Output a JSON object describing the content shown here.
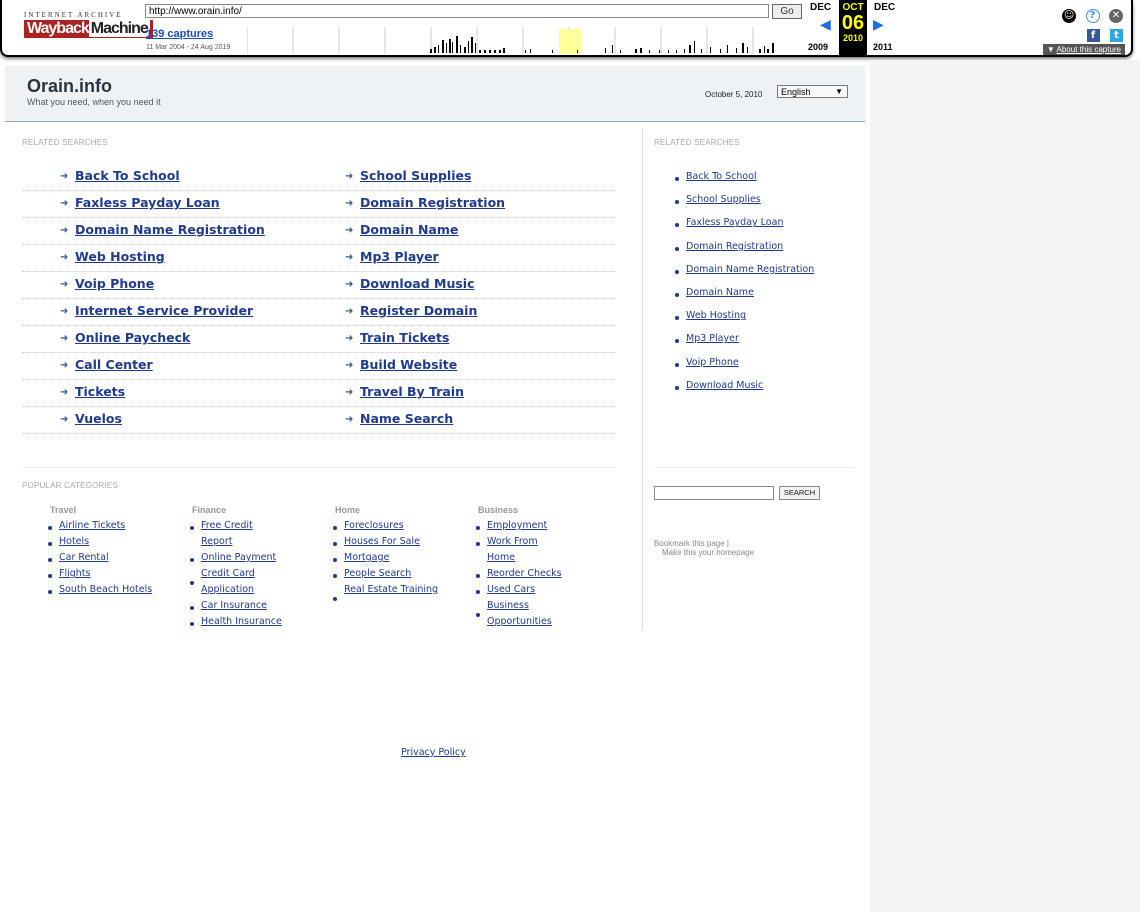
{
  "toolbar": {
    "ia_label": "INTERNET ARCHIVE",
    "logo": "WaybackMachine",
    "url_value": "http://www.orain.info/",
    "go_label": "Go",
    "captures_label": "139 captures",
    "date_range": "11 Mar 2004 - 24 Aug 2019",
    "prev_month": "DEC",
    "cur_month": "OCT",
    "next_month": "DEC",
    "cur_day": "06",
    "prev_year": "2009",
    "cur_year": "2010",
    "next_year": "2011",
    "about_label": "About this capture"
  },
  "header": {
    "site_title": "Orain.info",
    "tagline": "What you need, when you need it",
    "date": "October 5, 2010",
    "language": "English"
  },
  "related_label": "RELATED SEARCHES",
  "related_left": [
    "Back To School",
    "Faxless Payday Loan",
    "Domain Name Registration",
    "Web Hosting",
    "Voip Phone",
    "Internet Service Provider",
    "Online Paycheck",
    "Call Center",
    "Tickets",
    "Vuelos"
  ],
  "related_right": [
    "School Supplies",
    "Domain Registration",
    "Domain Name",
    "Mp3 Player",
    "Download Music",
    "Register Domain",
    "Train Tickets",
    "Build Website",
    "Travel By Train",
    "Name Search"
  ],
  "sidebar": {
    "label": "RELATED SEARCHES",
    "items": [
      "Back To School",
      "School Supplies",
      "Faxless Payday Loan",
      "Domain Registration",
      "Domain Name Registration",
      "Domain Name",
      "Web Hosting",
      "Mp3 Player",
      "Voip Phone",
      "Download Music"
    ],
    "search_button": "SEARCH",
    "bookmark": "Bookmark this page  |",
    "homepage": "Make this your homepage"
  },
  "popular_label": "POPULAR CATEGORIES",
  "categories": [
    {
      "title": "Travel",
      "items": [
        "Airline Tickets",
        "Hotels",
        "Car Rental",
        "Flights",
        "South Beach Hotels"
      ]
    },
    {
      "title": "Finance",
      "items": [
        "Free Credit Report",
        "Online Payment",
        "Credit Card Application",
        "Car Insurance",
        "Health Insurance"
      ]
    },
    {
      "title": "Home",
      "items": [
        "Foreclosures",
        "Houses For Sale",
        "Mortgage",
        "People Search",
        "Real Estate Training"
      ]
    },
    {
      "title": "Business",
      "items": [
        "Employment",
        "Work From Home",
        "Reorder Checks",
        "Used Cars",
        "Business Opportunities"
      ]
    }
  ],
  "footer": {
    "privacy": "Privacy Policy"
  },
  "colors": {
    "link": "#1f3a8f",
    "header_bg": "#eef2f5",
    "calendar_highlight": "#ffff00"
  }
}
